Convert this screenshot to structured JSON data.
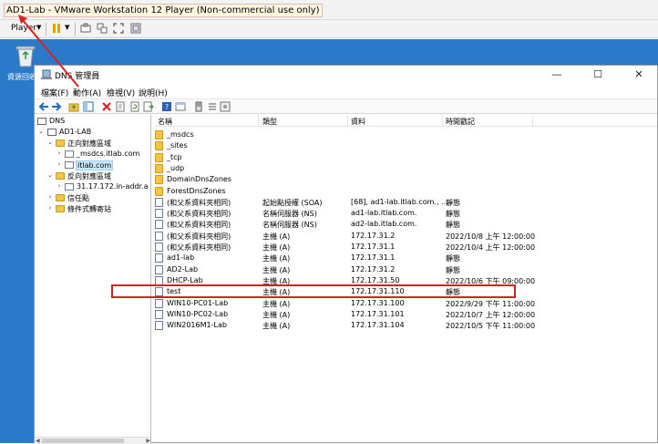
{
  "vmware": {
    "title": "AD1-Lab - VMware Workstation 12 Player (Non-commercial use only)",
    "player_menu": "Player",
    "toolbar_icons": [
      "pause-icon",
      "send-ctrl-alt-del-icon",
      "removable-devices-icon",
      "fullscreen-icon",
      "unity-icon"
    ]
  },
  "desktop": {
    "recycle_bin_label": "資源回收桶"
  },
  "dns_window": {
    "title": "DNS 管理員",
    "menu": [
      "檔案(F)",
      "動作(A)",
      "檢視(V)",
      "說明(H)"
    ],
    "tree": {
      "root": "DNS",
      "server": "AD1-LAB",
      "forward_zones": "正向對應區域",
      "msdcs_zone": "_msdcs.itlab.com",
      "itlab_zone": "itlab.com",
      "reverse_zones": "反向對應區域",
      "reverse_zone": "31.17.172.in-addr.a",
      "trust_points": "信任點",
      "conditional_forwarders": "條件式轉寄站"
    },
    "columns": [
      "名稱",
      "類型",
      "資料",
      "時間戳記"
    ],
    "rows": [
      {
        "name": "_msdcs",
        "type": "",
        "data": "",
        "timestamp": "",
        "kind": "folder"
      },
      {
        "name": "_sites",
        "type": "",
        "data": "",
        "timestamp": "",
        "kind": "folder"
      },
      {
        "name": "_tcp",
        "type": "",
        "data": "",
        "timestamp": "",
        "kind": "folder"
      },
      {
        "name": "_udp",
        "type": "",
        "data": "",
        "timestamp": "",
        "kind": "folder"
      },
      {
        "name": "DomainDnsZones",
        "type": "",
        "data": "",
        "timestamp": "",
        "kind": "folder"
      },
      {
        "name": "ForestDnsZones",
        "type": "",
        "data": "",
        "timestamp": "",
        "kind": "folder"
      },
      {
        "name": "(和父系資料夾相同)",
        "type": "起始點授權 (SOA)",
        "data": "[68], ad1-lab.itlab.com., ...",
        "timestamp": "靜態",
        "kind": "record"
      },
      {
        "name": "(和父系資料夾相同)",
        "type": "名稱伺服器 (NS)",
        "data": "ad1-lab.itlab.com.",
        "timestamp": "靜態",
        "kind": "record"
      },
      {
        "name": "(和父系資料夾相同)",
        "type": "名稱伺服器 (NS)",
        "data": "ad2-lab.itlab.com.",
        "timestamp": "靜態",
        "kind": "record"
      },
      {
        "name": "(和父系資料夾相同)",
        "type": "主機 (A)",
        "data": "172.17.31.2",
        "timestamp": "2022/10/8 上午 12:00:00",
        "kind": "record"
      },
      {
        "name": "(和父系資料夾相同)",
        "type": "主機 (A)",
        "data": "172.17.31.1",
        "timestamp": "2022/10/4 上午 12:00:00",
        "kind": "record"
      },
      {
        "name": "ad1-lab",
        "type": "主機 (A)",
        "data": "172.17.31.1",
        "timestamp": "靜態",
        "kind": "record"
      },
      {
        "name": "AD2-Lab",
        "type": "主機 (A)",
        "data": "172.17.31.2",
        "timestamp": "靜態",
        "kind": "record"
      },
      {
        "name": "DHCP-Lab",
        "type": "主機 (A)",
        "data": "172.17.31.50",
        "timestamp": "2022/10/6 下午 09:00:00",
        "kind": "record"
      },
      {
        "name": "test",
        "type": "主機 (A)",
        "data": "172.17.31.110",
        "timestamp": "靜態",
        "kind": "record"
      },
      {
        "name": "WIN10-PC01-Lab",
        "type": "主機 (A)",
        "data": "172.17.31.100",
        "timestamp": "2022/9/29 下午 11:00:00",
        "kind": "record"
      },
      {
        "name": "WIN10-PC02-Lab",
        "type": "主機 (A)",
        "data": "172.17.31.101",
        "timestamp": "2022/10/7 上午 12:00:00",
        "kind": "record"
      },
      {
        "name": "WIN2016M1-Lab",
        "type": "主機 (A)",
        "data": "172.17.31.104",
        "timestamp": "2022/10/5 下午 11:00:00",
        "kind": "record"
      }
    ]
  },
  "colors": {
    "desktop_background": "#2b79c9",
    "highlight_box": "#d42020",
    "annotation_arrow": "#e02020"
  }
}
